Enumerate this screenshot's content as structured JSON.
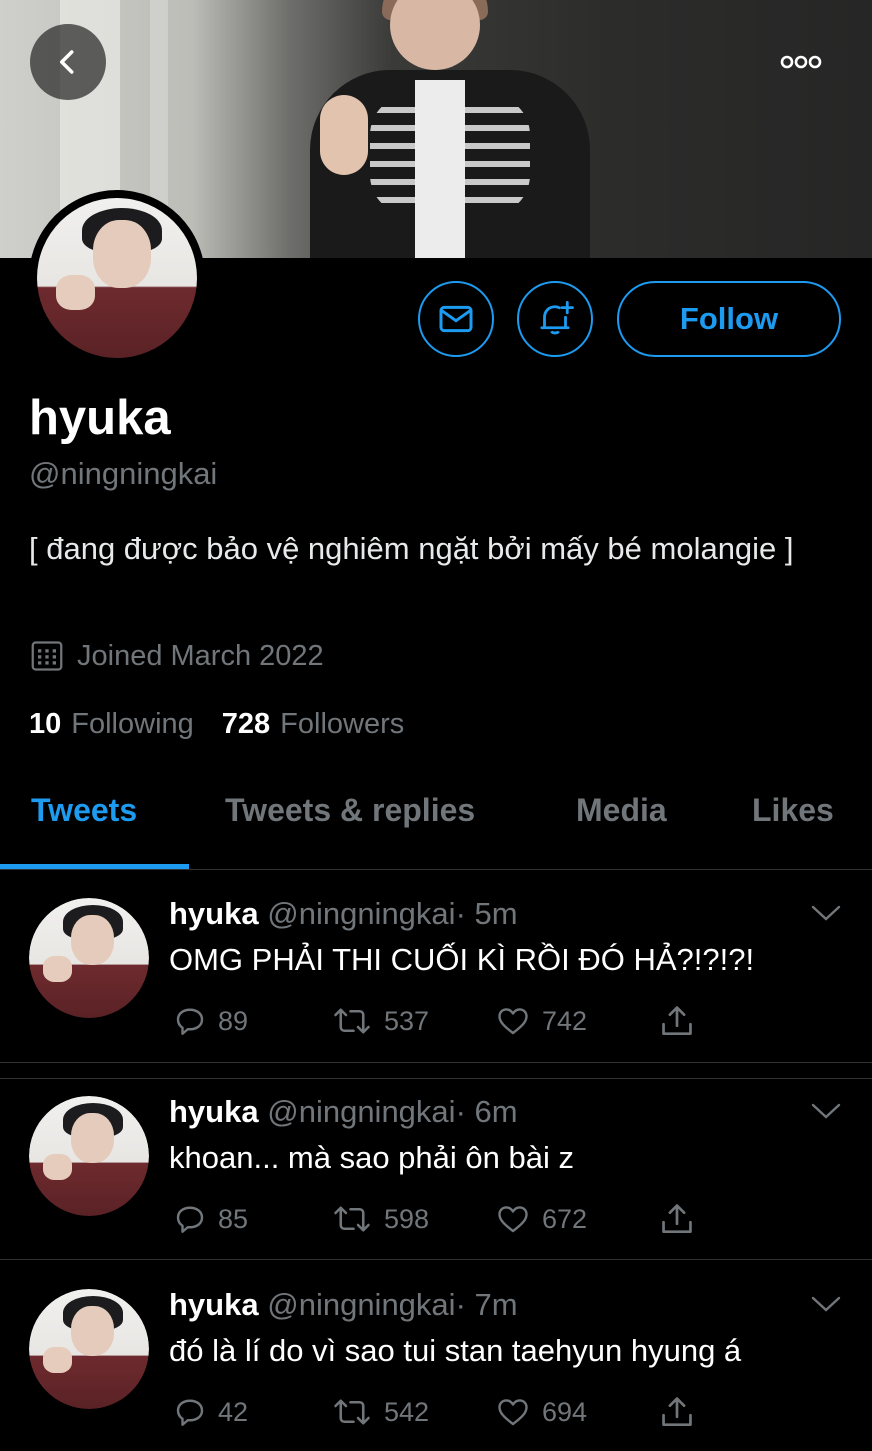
{
  "profile": {
    "name": "hyuka",
    "handle": "@ningningkai",
    "bio": "[ đang được bảo vệ nghiêm ngặt bởi mấy bé molangie ]",
    "joined": "Joined March 2022",
    "following_count": "10",
    "following_label": "Following",
    "followers_count": "728",
    "followers_label": "Followers"
  },
  "buttons": {
    "follow": "Follow",
    "message_icon": "mail-icon",
    "notify_icon": "bell-plus-icon",
    "back_icon": "back-arrow-icon",
    "more_icon": "more-dots-icon"
  },
  "tabs": [
    {
      "label": "Tweets",
      "active": true
    },
    {
      "label": "Tweets & replies",
      "active": false
    },
    {
      "label": "Media",
      "active": false
    },
    {
      "label": "Likes",
      "active": false
    }
  ],
  "tweets": [
    {
      "name": "hyuka",
      "handle": "@ningningkai",
      "time": "· 5m",
      "text": "OMG PHẢI THI CUỐI KÌ RỒI ĐÓ HẢ?!?!?!",
      "replies": "89",
      "retweets": "537",
      "likes": "742"
    },
    {
      "name": "hyuka",
      "handle": "@ningningkai",
      "time": "· 6m",
      "text": "khoan... mà sao phải ôn bài z",
      "replies": "85",
      "retweets": "598",
      "likes": "672"
    },
    {
      "name": "hyuka",
      "handle": "@ningningkai",
      "time": "· 7m",
      "text": "đó là lí do vì sao tui stan taehyun hyung á",
      "replies": "42",
      "retweets": "542",
      "likes": "694"
    }
  ],
  "colors": {
    "accent": "#1d9bf0",
    "background": "#000000",
    "muted": "#71767b",
    "divider": "#2f3336"
  }
}
